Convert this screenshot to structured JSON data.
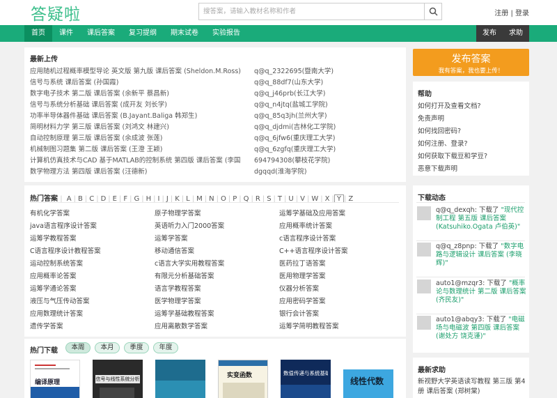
{
  "header": {
    "logo": "答疑啦",
    "search_placeholder": "搜答案，请输入教材名称和作者",
    "auth_register": "注册",
    "auth_sep": "|",
    "auth_login": "登录"
  },
  "nav": {
    "items": [
      "首页",
      "课件",
      "课后答案",
      "复习提纲",
      "期末试卷",
      "实验报告"
    ],
    "right": [
      "发布",
      "求助"
    ]
  },
  "latest": {
    "title": "最新上传",
    "rows": [
      {
        "book": "应用随机过程概率模型导论 英文版 第九版 课后答案 (Sheldon.M.Ross)",
        "user": "q@q_2322695(暨南大学)"
      },
      {
        "book": "信号与系统 课后答案 (孙国霞)",
        "user": "q@q_88df7(山东大学)"
      },
      {
        "book": "数字电子技术 第二版 课后答案 (余新平 蔡昌新)",
        "user": "q@q_j46prb(长江大学)"
      },
      {
        "book": "信号与系统分析基础 课后答案 (成开友 刘长学)",
        "user": "q@q_n4jtq(盐城工学院)"
      },
      {
        "book": "功率半导体器件基础 课后答案 (B.Jayant.Baliga 韩郑生)",
        "user": "q@q_85q3jh(兰州大学)"
      },
      {
        "book": "简明材料力学 第三版 课后答案 (刘鸿文 林建兴)",
        "user": "q@q_djdmi(吉林化工学院)"
      },
      {
        "book": "自动控制原理 第三版 课后答案 (余成波 张莲)",
        "user": "q@q_6jfw6(重庆理工大学)"
      },
      {
        "book": "机械制图习题集 第二版 课后答案 (王澄 王颖)",
        "user": "q@q_6zgfq(重庆理工大学)"
      },
      {
        "book": "计算机仿真技术与CAD 基于MATLAB的控制系统 第四版 课后答案 (李国",
        "user": "694794308(攀枝花学院)"
      },
      {
        "book": "数学物理方法 第四版 课后答案 (汪德新)",
        "user": "dgqqd(淮海学院)"
      }
    ]
  },
  "hot": {
    "title": "热门答案",
    "letters": [
      "A",
      "B",
      "C",
      "D",
      "E",
      "F",
      "G",
      "H",
      "I",
      "J",
      "K",
      "L",
      "M",
      "N",
      "O",
      "P",
      "Q",
      "R",
      "S",
      "T",
      "U",
      "V",
      "W",
      "X",
      "Y",
      "Z"
    ],
    "active_letter": "Y",
    "col1": [
      "有机化学答案",
      "java语言程序设计答案",
      "运筹学教程答案",
      "C语言程序设计教程答案",
      "运动控制系统答案",
      "应用概率论答案",
      "运筹学通论答案",
      "液压与气压传动答案",
      "应用数理统计答案",
      "遗传学答案"
    ],
    "col2": [
      "原子物理学答案",
      "英语听力入门2000答案",
      "运筹学答案",
      "移动通信答案",
      "c语言大学实用教程答案",
      "有限元分析基础答案",
      "语言学教程答案",
      "医学物理学答案",
      "运筹学基础教程答案",
      "应用离散数学答案"
    ],
    "col3": [
      "运筹学基础及应用答案",
      "应用概率统计答案",
      "c语言程序设计答案",
      "C++语言程序设计答案",
      "医药拉丁语答案",
      "医用物理学答案",
      "仪器分析答案",
      "应用密码学答案",
      "银行会计答案",
      "运筹学简明教程答案"
    ]
  },
  "downloads": {
    "title": "热门下载",
    "tabs": [
      "本周",
      "本月",
      "季度",
      "年度"
    ],
    "books": [
      "编译原理",
      "信号与线性系统分析",
      "",
      "实变函数",
      "数值传递与系统基础",
      "线性代数"
    ]
  },
  "sidebar": {
    "publish_title": "发布答案",
    "publish_sub": "我有答案，我也要上传！",
    "help_title": "帮助",
    "help_links": [
      "如何打开及查看文档?",
      "免责声明",
      "如何找回密码?",
      "如何注册、登录?",
      "如何获取下载豆和学豆?",
      "恶意下载声明"
    ],
    "dl_title": "下载动态",
    "dl_items": [
      {
        "user": "q@q_dexqh",
        "verb": "下载了",
        "book": "\"现代控制工程 第五版 课后答案 (Katsuhiko.Ogata 卢伯英)\""
      },
      {
        "user": "q@q_z8pnp",
        "verb": "下载了",
        "book": "\"数字电路与逻辑设计 课后答案 (李晓辉)\""
      },
      {
        "user": "auto1@mzqr3",
        "verb": "下载了",
        "book": "\"概率论与数理统计 第二版 课后答案 (齐民友)\""
      },
      {
        "user": "auto1@abqy3",
        "verb": "下载了",
        "book": "\"电磁场与电磁波 第四版 课后答案 (谢处方 饶克谨)\""
      }
    ],
    "help_req_title": "最新求助",
    "help_req_text": "新视野大学英语读写教程 第三版 第4册 课后答案 (郑树棠)"
  },
  "colors": {
    "green": "#1aab7a",
    "orange": "#f39c1e",
    "link": "#1a9e6b"
  }
}
